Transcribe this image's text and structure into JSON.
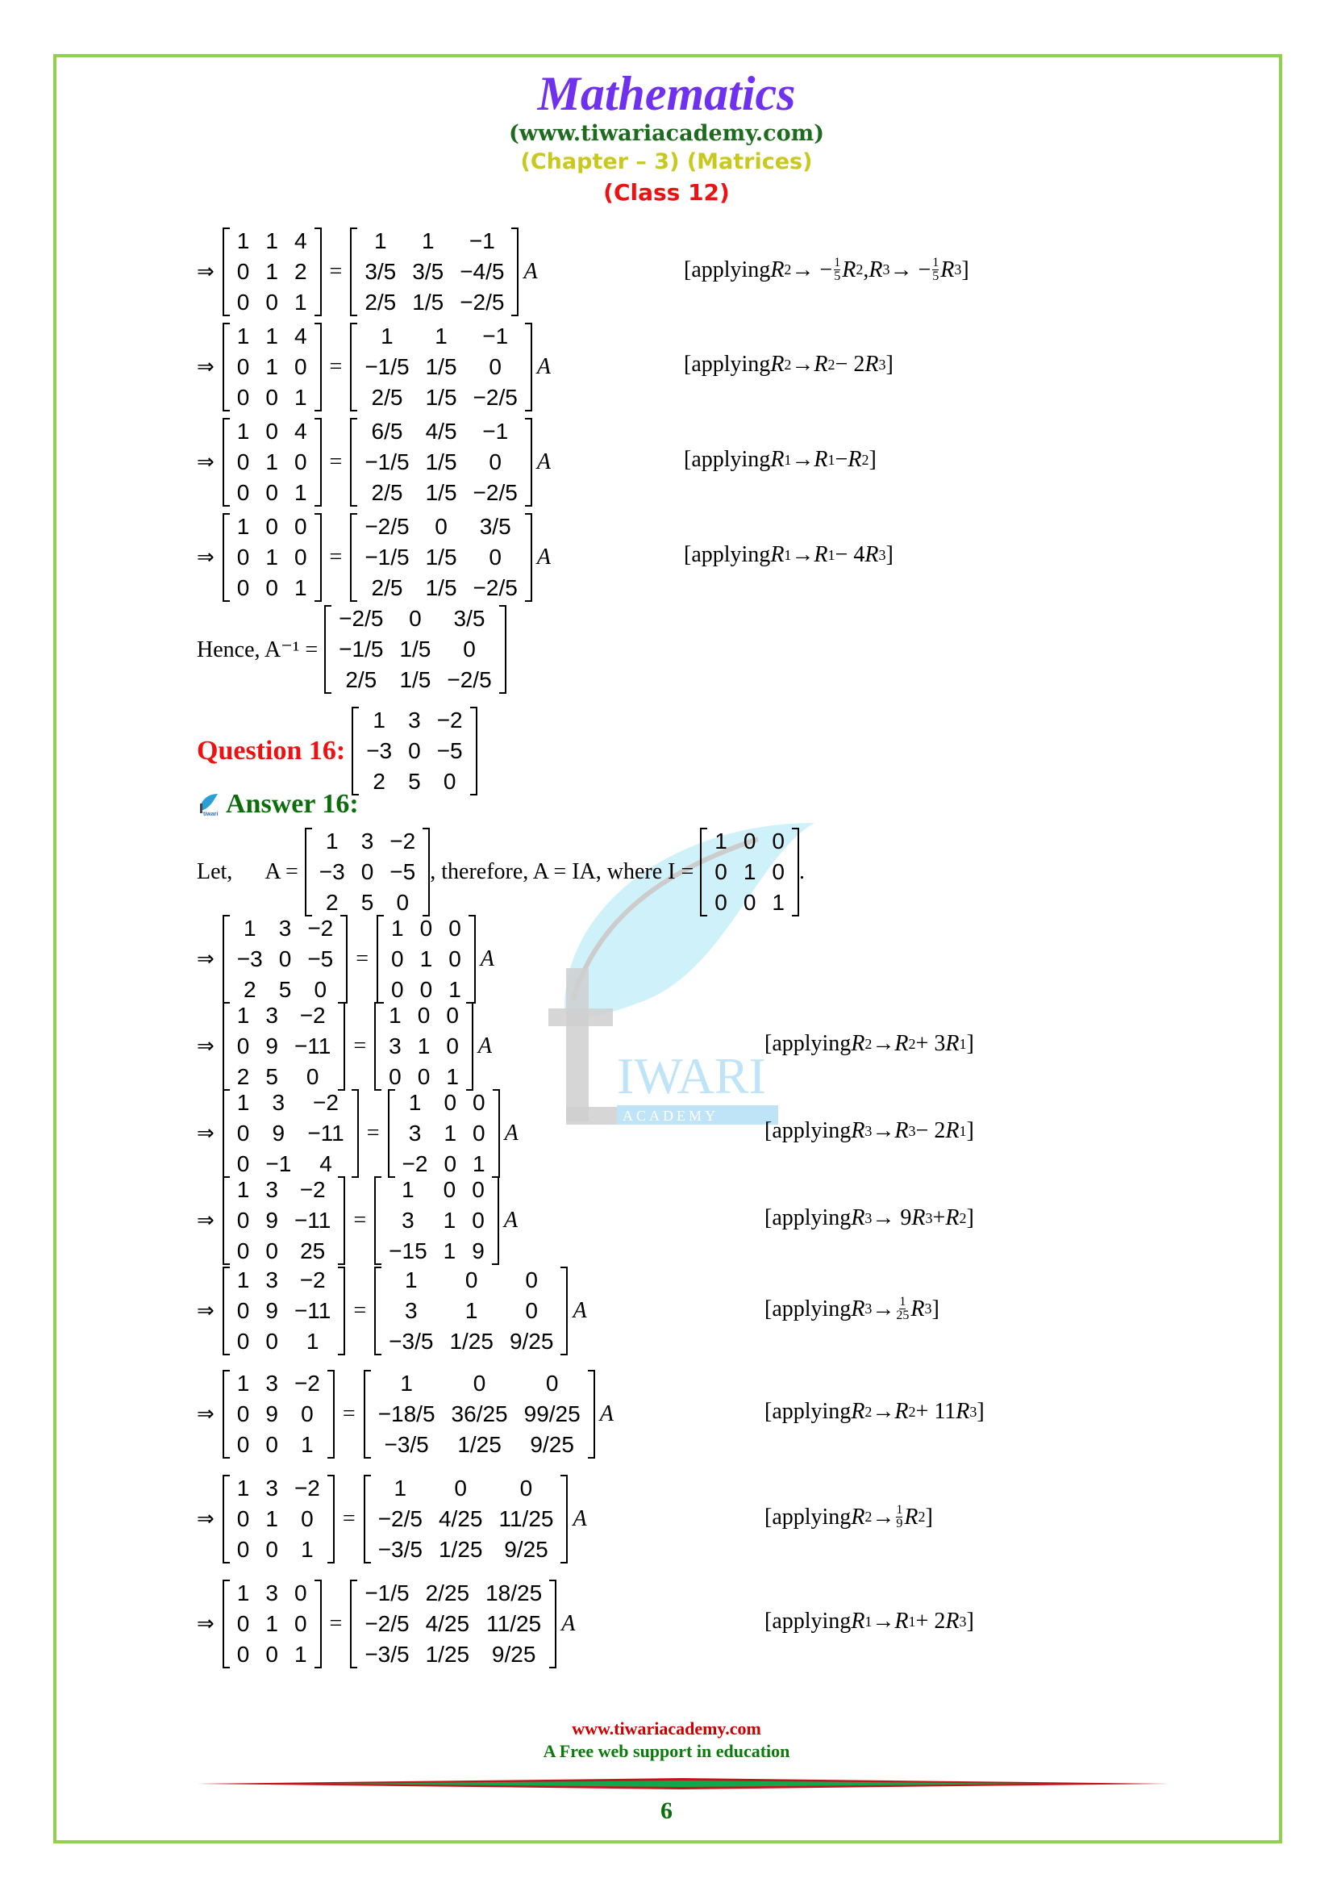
{
  "header": {
    "title": "Mathematics",
    "site": "(www.tiwariacademy.com)",
    "chapter": "(Chapter – 3) (Matrices)",
    "class": "(Class 12)"
  },
  "symbols": {
    "implies": "⇒",
    "equals": "=",
    "A": "A"
  },
  "steps_q15": [
    {
      "left": [
        [
          "1",
          "1",
          "4"
        ],
        [
          "0",
          "1",
          "2"
        ],
        [
          "0",
          "0",
          "1"
        ]
      ],
      "right": [
        [
          "1",
          "1",
          "−1"
        ],
        [
          "3/5",
          "3/5",
          "−4/5"
        ],
        [
          "2/5",
          "1/5",
          "−2/5"
        ]
      ],
      "note": "applying R2 → −(1/5)R2, R3 → −(1/5)R3"
    },
    {
      "left": [
        [
          "1",
          "1",
          "4"
        ],
        [
          "0",
          "1",
          "0"
        ],
        [
          "0",
          "0",
          "1"
        ]
      ],
      "right": [
        [
          "1",
          "1",
          "−1"
        ],
        [
          "−1/5",
          "1/5",
          "0"
        ],
        [
          "2/5",
          "1/5",
          "−2/5"
        ]
      ],
      "note": "applying R2 → R2 − 2R3"
    },
    {
      "left": [
        [
          "1",
          "0",
          "4"
        ],
        [
          "0",
          "1",
          "0"
        ],
        [
          "0",
          "0",
          "1"
        ]
      ],
      "right": [
        [
          "6/5",
          "4/5",
          "−1"
        ],
        [
          "−1/5",
          "1/5",
          "0"
        ],
        [
          "2/5",
          "1/5",
          "−2/5"
        ]
      ],
      "note": "applying R1 → R1 − R2"
    },
    {
      "left": [
        [
          "1",
          "0",
          "0"
        ],
        [
          "0",
          "1",
          "0"
        ],
        [
          "0",
          "0",
          "1"
        ]
      ],
      "right": [
        [
          "−2/5",
          "0",
          "3/5"
        ],
        [
          "−1/5",
          "1/5",
          "0"
        ],
        [
          "2/5",
          "1/5",
          "−2/5"
        ]
      ],
      "note": "applying R1 → R1 − 4R3"
    }
  ],
  "hence": {
    "label": "Hence, A⁻¹ =",
    "matrix": [
      [
        "−2/5",
        "0",
        "3/5"
      ],
      [
        "−1/5",
        "1/5",
        "0"
      ],
      [
        "2/5",
        "1/5",
        "−2/5"
      ]
    ]
  },
  "question16": {
    "label": "Question 16:",
    "matrix": [
      [
        "1",
        "3",
        "−2"
      ],
      [
        "−3",
        "0",
        "−5"
      ],
      [
        "2",
        "5",
        "0"
      ]
    ]
  },
  "answer16": {
    "label": "Answer 16:",
    "let": "Let,",
    "A_eq": "A =",
    "therefore": ", therefore, A = IA, where I =",
    "A_matrix": [
      [
        "1",
        "3",
        "−2"
      ],
      [
        "−3",
        "0",
        "−5"
      ],
      [
        "2",
        "5",
        "0"
      ]
    ],
    "I_matrix": [
      [
        "1",
        "0",
        "0"
      ],
      [
        "0",
        "1",
        "0"
      ],
      [
        "0",
        "0",
        "1"
      ]
    ],
    "period": "."
  },
  "steps_q16": [
    {
      "left": [
        [
          "1",
          "3",
          "−2"
        ],
        [
          "−3",
          "0",
          "−5"
        ],
        [
          "2",
          "5",
          "0"
        ]
      ],
      "right": [
        [
          "1",
          "0",
          "0"
        ],
        [
          "0",
          "1",
          "0"
        ],
        [
          "0",
          "0",
          "1"
        ]
      ],
      "note": ""
    },
    {
      "left": [
        [
          "1",
          "3",
          "−2"
        ],
        [
          "0",
          "9",
          "−11"
        ],
        [
          "2",
          "5",
          "0"
        ]
      ],
      "right": [
        [
          "1",
          "0",
          "0"
        ],
        [
          "3",
          "1",
          "0"
        ],
        [
          "0",
          "0",
          "1"
        ]
      ],
      "note": "applying R2 → R2 + 3R1"
    },
    {
      "left": [
        [
          "1",
          "3",
          "−2"
        ],
        [
          "0",
          "9",
          "−11"
        ],
        [
          "0",
          "−1",
          "4"
        ]
      ],
      "right": [
        [
          "1",
          "0",
          "0"
        ],
        [
          "3",
          "1",
          "0"
        ],
        [
          "−2",
          "0",
          "1"
        ]
      ],
      "note": "applying R3 → R3 − 2R1"
    },
    {
      "left": [
        [
          "1",
          "3",
          "−2"
        ],
        [
          "0",
          "9",
          "−11"
        ],
        [
          "0",
          "0",
          "25"
        ]
      ],
      "right": [
        [
          "1",
          "0",
          "0"
        ],
        [
          "3",
          "1",
          "0"
        ],
        [
          "−15",
          "1",
          "9"
        ]
      ],
      "note": "applying R3 → 9R3 + R2"
    },
    {
      "left": [
        [
          "1",
          "3",
          "−2"
        ],
        [
          "0",
          "9",
          "−11"
        ],
        [
          "0",
          "0",
          "1"
        ]
      ],
      "right": [
        [
          "1",
          "0",
          "0"
        ],
        [
          "3",
          "1",
          "0"
        ],
        [
          "−3/5",
          "1/25",
          "9/25"
        ]
      ],
      "note": "applying R3 → (1/25)R3"
    },
    {
      "left": [
        [
          "1",
          "3",
          "−2"
        ],
        [
          "0",
          "9",
          "0"
        ],
        [
          "0",
          "0",
          "1"
        ]
      ],
      "right": [
        [
          "1",
          "0",
          "0"
        ],
        [
          "−18/5",
          "36/25",
          "99/25"
        ],
        [
          "−3/5",
          "1/25",
          "9/25"
        ]
      ],
      "note": "applying R2 → R2 + 11R3"
    },
    {
      "left": [
        [
          "1",
          "3",
          "−2"
        ],
        [
          "0",
          "1",
          "0"
        ],
        [
          "0",
          "0",
          "1"
        ]
      ],
      "right": [
        [
          "1",
          "0",
          "0"
        ],
        [
          "−2/5",
          "4/25",
          "11/25"
        ],
        [
          "−3/5",
          "1/25",
          "9/25"
        ]
      ],
      "note": "applying R2 → (1/9)R2"
    },
    {
      "left": [
        [
          "1",
          "3",
          "0"
        ],
        [
          "0",
          "1",
          "0"
        ],
        [
          "0",
          "0",
          "1"
        ]
      ],
      "right": [
        [
          "−1/5",
          "2/25",
          "18/25"
        ],
        [
          "−2/5",
          "4/25",
          "11/25"
        ],
        [
          "−3/5",
          "1/25",
          "9/25"
        ]
      ],
      "note": "applying R1 → R1 + 2R3"
    }
  ],
  "watermark": {
    "text": "IWARI",
    "subtext": "A C A D E M Y",
    "icon": "tiwari-leaf-logo"
  },
  "footer": {
    "site": "www.tiwariacademy.com",
    "tagline": "A Free web support in education",
    "page_number": "6"
  },
  "colors": {
    "border": "#92d050",
    "title": "#7030f0",
    "site": "#1e6a1e",
    "chapter": "#c8c81e",
    "class": "#ee1111",
    "question": "#ee1111",
    "answer": "#0b6e0b"
  }
}
